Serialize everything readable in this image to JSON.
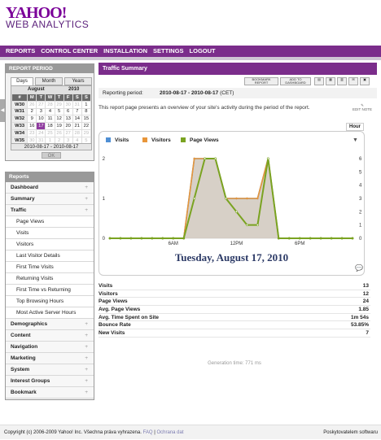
{
  "brand": {
    "logo": "YAHOO!",
    "product": "WEB ANALYTICS"
  },
  "nav": {
    "items": [
      "REPORTS",
      "CONTROL CENTER",
      "INSTALLATION",
      "SETTINGS",
      "LOGOUT"
    ]
  },
  "report_period": {
    "title": "REPORT PERIOD",
    "tabs": [
      "Days",
      "Month",
      "Years"
    ],
    "month": "August",
    "year": "2010",
    "weekday_headers": [
      "#",
      "M",
      "T",
      "W",
      "T",
      "F",
      "S",
      "S"
    ],
    "weeks": [
      [
        "W30",
        "26",
        "27",
        "28",
        "29",
        "30",
        "31",
        "1"
      ],
      [
        "W31",
        "2",
        "3",
        "4",
        "5",
        "6",
        "7",
        "8"
      ],
      [
        "W32",
        "9",
        "10",
        "11",
        "12",
        "13",
        "14",
        "15"
      ],
      [
        "W33",
        "16",
        "17",
        "18",
        "19",
        "20",
        "21",
        "22"
      ],
      [
        "W34",
        "23",
        "24",
        "25",
        "26",
        "27",
        "28",
        "29"
      ],
      [
        "W35",
        "30",
        "31",
        "1",
        "2",
        "3",
        "4",
        "5"
      ]
    ],
    "selected_day": "17",
    "range": "2010-08-17 - 2010-08-17",
    "ok": "OK"
  },
  "reports": {
    "title": "Reports",
    "items": [
      {
        "label": "Dashboard",
        "level": "top",
        "icon": "+"
      },
      {
        "label": "Summary",
        "level": "top",
        "icon": "+"
      },
      {
        "label": "Traffic",
        "level": "top",
        "icon": "+"
      },
      {
        "label": "Page Views",
        "level": "sub",
        "icon": ""
      },
      {
        "label": "Visits",
        "level": "sub",
        "icon": ""
      },
      {
        "label": "Visitors",
        "level": "sub",
        "icon": ""
      },
      {
        "label": "Last Visitor Details",
        "level": "sub",
        "icon": ""
      },
      {
        "label": "First Time Visits",
        "level": "sub",
        "icon": ""
      },
      {
        "label": "Returning Visits",
        "level": "sub",
        "icon": ""
      },
      {
        "label": "First Time vs Returning",
        "level": "sub",
        "icon": ""
      },
      {
        "label": "Top Browsing Hours",
        "level": "sub",
        "icon": ""
      },
      {
        "label": "Most Active Server Hours",
        "level": "sub",
        "icon": ""
      },
      {
        "label": "Demographics",
        "level": "top",
        "icon": "+"
      },
      {
        "label": "Content",
        "level": "top",
        "icon": "+"
      },
      {
        "label": "Navigation",
        "level": "top",
        "icon": "+"
      },
      {
        "label": "Marketing",
        "level": "top",
        "icon": "+"
      },
      {
        "label": "System",
        "level": "top",
        "icon": "+"
      },
      {
        "label": "Interest Groups",
        "level": "top",
        "icon": "+"
      },
      {
        "label": "Bookmark",
        "level": "top",
        "icon": "+"
      }
    ]
  },
  "main": {
    "title": "Traffic Summary",
    "toolbar": {
      "bookmark": "BOOKMARK REPORT",
      "add_dashboard": "ADD TO DASHBOARD"
    },
    "period_label": "Reporting period:",
    "period_value": "2010-08-17 - 2010-08-17",
    "period_tz": "(CET)",
    "description": "This report page presents an overview of your site's activity during the period of the report.",
    "edit_note": "EDIT NOTE",
    "hour_tab": "Hour",
    "date_caption": "Tuesday, August 17, 2010"
  },
  "chart_data": {
    "type": "line",
    "x": [
      0,
      1,
      2,
      3,
      4,
      5,
      6,
      7,
      8,
      9,
      10,
      11,
      12,
      13,
      14,
      15,
      16,
      17,
      18,
      19,
      20,
      21,
      22,
      23
    ],
    "x_tick_labels": [
      "6AM",
      "12PM",
      "6PM"
    ],
    "x_tick_positions": [
      6,
      12,
      18
    ],
    "series": [
      {
        "name": "Visits",
        "axis": "left",
        "color": "#4f8fd4",
        "values": [
          0,
          0,
          0,
          0,
          0,
          0,
          0,
          0,
          2,
          2,
          2,
          1,
          1,
          1,
          1,
          2,
          0,
          0,
          0,
          0,
          0,
          0,
          0,
          0
        ]
      },
      {
        "name": "Visitors",
        "axis": "left",
        "color": "#e8963a",
        "values": [
          0,
          0,
          0,
          0,
          0,
          0,
          0,
          0,
          2,
          2,
          2,
          1,
          1,
          1,
          1,
          2,
          0,
          0,
          0,
          0,
          0,
          0,
          0,
          0
        ]
      },
      {
        "name": "Page Views",
        "axis": "right",
        "color": "#7aa321",
        "values": [
          0,
          0,
          0,
          0,
          0,
          0,
          0,
          0,
          3,
          6,
          6,
          3,
          2,
          1,
          1,
          6,
          0,
          0,
          0,
          0,
          0,
          0,
          0,
          0
        ]
      }
    ],
    "ylim_left": [
      0,
      2
    ],
    "yticks_left": [
      0,
      1,
      2
    ],
    "ylim_right": [
      0,
      6
    ],
    "yticks_right": [
      0,
      1,
      2,
      3,
      4,
      5,
      6
    ],
    "legend": "top-left",
    "grid": false
  },
  "stats": [
    {
      "label": "Visits",
      "value": "13"
    },
    {
      "label": "Visitors",
      "value": "12"
    },
    {
      "label": "Page Views",
      "value": "24"
    },
    {
      "label": "Avg. Page Views",
      "value": "1.85"
    },
    {
      "label": "Avg. Time Spent on Site",
      "value": "1m 54s"
    },
    {
      "label": "Bounce Rate",
      "value": "53.85%"
    },
    {
      "label": "New Visits",
      "value": "7"
    }
  ],
  "generation_time": "Generation time: 771 ms",
  "footer": {
    "copyright": "Copyright (c) 2006-2009 Yahoo! Inc. Všechna práva vyhrazena.",
    "faq": "FAQ",
    "privacy": "Ochrana dat",
    "provider": "Poskytovatelem softwaru"
  }
}
